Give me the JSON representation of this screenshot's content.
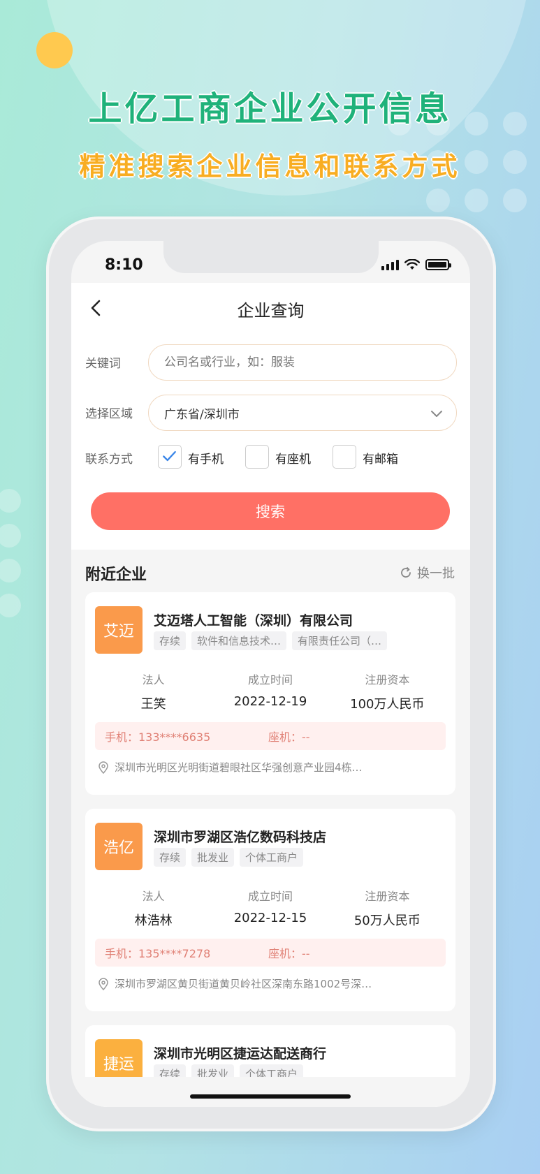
{
  "hero": {
    "title": "上亿工商企业公开信息",
    "subtitle": "精准搜索企业信息和联系方式"
  },
  "status_bar": {
    "time": "8:10"
  },
  "nav": {
    "title": "企业查询"
  },
  "form": {
    "keyword_label": "关键词",
    "keyword_placeholder": "公司名或行业，如：服装",
    "region_label": "选择区域",
    "region_value": "广东省/深圳市",
    "contact_label": "联系方式",
    "options": [
      {
        "label": "有手机",
        "checked": true
      },
      {
        "label": "有座机",
        "checked": false
      },
      {
        "label": "有邮箱",
        "checked": false
      }
    ],
    "search_button": "搜索"
  },
  "section": {
    "title": "附近企业",
    "refresh": "换一批"
  },
  "companies": [
    {
      "avatar": "艾迈",
      "name": "艾迈塔人工智能（深圳）有限公司",
      "tags": [
        "存续",
        "软件和信息技术…",
        "有限责任公司（…"
      ],
      "legal_label": "法人",
      "legal_value": "王笑",
      "date_label": "成立时间",
      "date_value": "2022-12-19",
      "capital_label": "注册资本",
      "capital_value": "100万人民币",
      "phone": "手机：133****6635",
      "landline": "座机：--",
      "address": "深圳市光明区光明街道碧眼社区华强创意产业园4栋…"
    },
    {
      "avatar": "浩亿",
      "name": "深圳市罗湖区浩亿数码科技店",
      "tags": [
        "存续",
        "批发业",
        "个体工商户"
      ],
      "legal_label": "法人",
      "legal_value": "林浩林",
      "date_label": "成立时间",
      "date_value": "2022-12-15",
      "capital_label": "注册资本",
      "capital_value": "50万人民币",
      "phone": "手机：135****7278",
      "landline": "座机：--",
      "address": "深圳市罗湖区黄贝街道黄贝岭社区深南东路1002号深…"
    },
    {
      "avatar": "捷运",
      "name": "深圳市光明区捷运达配送商行",
      "tags": [
        "存续",
        "批发业",
        "个体工商户"
      ]
    }
  ],
  "colors": {
    "accent": "#ff7065",
    "hero_title": "#1fb27a",
    "hero_subtitle": "#f8ad22",
    "avatar": "#fa9a4b",
    "check": "#3a86e8"
  }
}
